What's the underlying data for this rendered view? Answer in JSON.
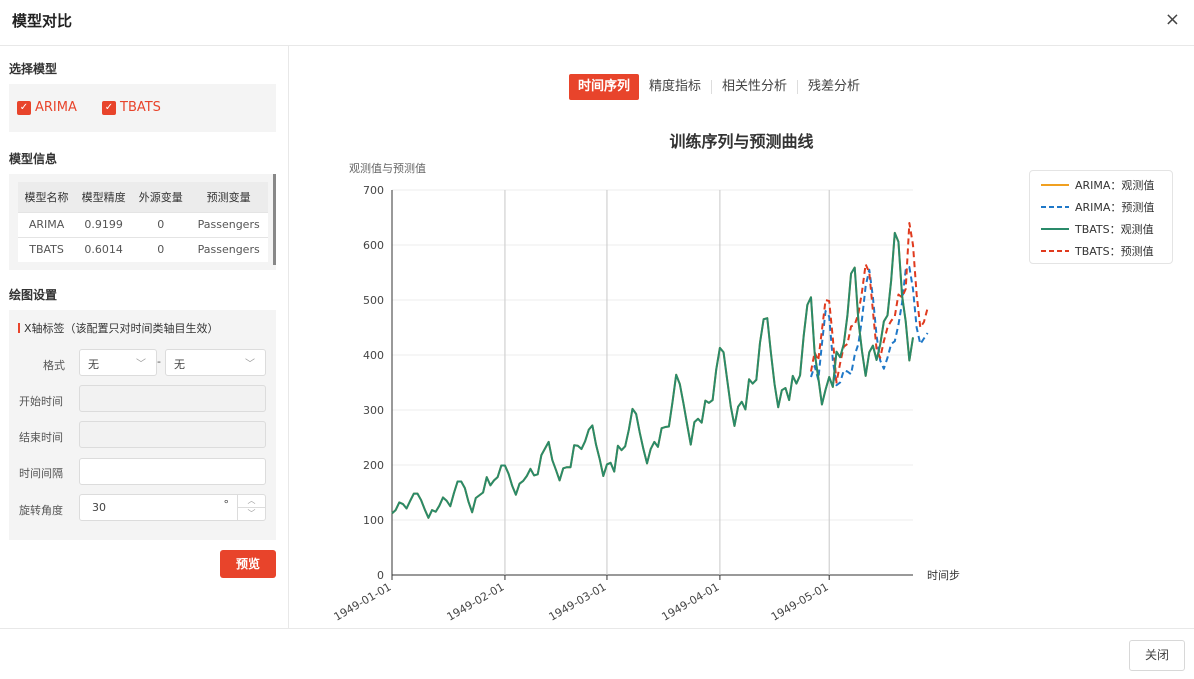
{
  "dialog": {
    "title": "模型对比",
    "close_icon": "×"
  },
  "left": {
    "select_models": {
      "title": "选择模型",
      "models": [
        {
          "label": "ARIMA",
          "checked": true
        },
        {
          "label": "TBATS",
          "checked": true
        }
      ]
    },
    "model_info": {
      "title": "模型信息",
      "columns": [
        "模型名称",
        "模型精度",
        "外源变量",
        "预测变量"
      ],
      "rows": [
        [
          "ARIMA",
          "0.9199",
          "0",
          "Passengers"
        ],
        [
          "TBATS",
          "0.6014",
          "0",
          "Passengers"
        ]
      ]
    },
    "plot_settings": {
      "title": "绘图设置",
      "subtitle": "X轴标签（该配置只对时间类轴目生效）",
      "format_label": "格式",
      "format_value_1": "无",
      "format_separator": "-",
      "format_value_2": "无",
      "start_label": "开始时间",
      "end_label": "结束时间",
      "interval_label": "时间间隔",
      "rotation_label": "旋转角度",
      "rotation_value": "30",
      "rotation_unit": "°",
      "preview_button": "预览"
    }
  },
  "tabs": [
    {
      "label": "时间序列",
      "active": true
    },
    {
      "label": "精度指标",
      "active": false
    },
    {
      "label": "相关性分析",
      "active": false
    },
    {
      "label": "残差分析",
      "active": false
    }
  ],
  "footer": {
    "close_button": "关闭"
  },
  "chart_data": {
    "type": "line",
    "title": "训练序列与预测曲线",
    "ylabel": "观测值与预测值",
    "xlabel": "时间步",
    "ylim": [
      0,
      700
    ],
    "yticks": [
      0,
      100,
      200,
      300,
      400,
      500,
      600,
      700
    ],
    "xticks": [
      "1949-01-01",
      "1949-02-01",
      "1949-03-01",
      "1949-04-01",
      "1949-05-01"
    ],
    "x_tick_positions_index": [
      0,
      31,
      59,
      90,
      120
    ],
    "legend_position": "top-right",
    "series": [
      {
        "name": "ARIMA：观测值",
        "color": "#f0a020",
        "dash": false,
        "values": [
          112,
          118,
          132,
          129,
          121,
          135,
          148,
          148,
          136,
          119,
          104,
          118,
          115,
          126,
          141,
          135,
          125,
          149,
          170,
          170,
          158,
          133,
          114,
          140,
          145,
          150,
          178,
          163,
          172,
          178,
          199,
          199,
          184,
          162,
          146,
          166,
          171,
          180,
          193,
          181,
          183,
          218,
          230,
          242,
          209,
          191,
          172,
          194,
          196,
          196,
          236,
          235,
          229,
          243,
          264,
          272,
          237,
          211,
          180,
          201,
          204,
          188,
          235,
          227,
          234,
          264,
          302,
          293,
          259,
          229,
          203,
          229,
          242,
          233,
          267,
          269,
          270,
          315,
          364,
          347,
          312,
          274,
          237,
          278,
          284,
          277,
          317,
          313,
          318,
          374,
          413,
          405,
          355,
          306,
          271,
          306,
          315,
          301,
          356,
          348,
          355,
          422,
          465,
          467,
          404,
          347,
          305,
          336,
          340,
          318,
          362,
          348,
          363,
          435,
          491,
          505,
          404,
          359,
          310,
          337,
          360,
          342,
          406,
          396,
          420,
          472,
          548,
          559,
          463,
          407,
          362,
          405,
          417,
          391,
          419,
          461,
          472,
          535,
          622,
          606,
          508,
          461,
          390,
          432
        ]
      },
      {
        "name": "ARIMA：预测值",
        "color": "#1f78c8",
        "dash": true,
        "values": [
          null,
          null,
          null,
          null,
          null,
          null,
          null,
          null,
          null,
          null,
          null,
          null,
          null,
          null,
          null,
          null,
          null,
          null,
          null,
          null,
          null,
          null,
          null,
          null,
          null,
          null,
          null,
          null,
          null,
          null,
          null,
          null,
          null,
          null,
          null,
          null,
          null,
          null,
          null,
          null,
          null,
          null,
          null,
          null,
          null,
          null,
          null,
          null,
          null,
          null,
          null,
          null,
          null,
          null,
          null,
          null,
          null,
          null,
          null,
          null,
          null,
          null,
          null,
          null,
          null,
          null,
          null,
          null,
          null,
          null,
          null,
          null,
          null,
          null,
          null,
          null,
          null,
          null,
          null,
          null,
          null,
          null,
          null,
          null,
          null,
          null,
          null,
          null,
          null,
          null,
          null,
          null,
          null,
          null,
          null,
          null,
          null,
          null,
          null,
          null,
          null,
          null,
          null,
          null,
          null,
          null,
          null,
          null,
          null,
          null,
          null,
          null,
          null,
          null,
          null,
          360,
          380,
          355,
          420,
          480,
          470,
          390,
          345,
          350,
          372,
          370,
          365,
          400,
          420,
          465,
          525,
          555,
          505,
          435,
          390,
          375,
          395,
          420,
          425,
          455,
          495,
          555,
          560,
          520,
          450,
          420,
          430,
          440
        ]
      },
      {
        "name": "TBATS：观测值",
        "color": "#2a8a6a",
        "dash": false,
        "values": [
          112,
          118,
          132,
          129,
          121,
          135,
          148,
          148,
          136,
          119,
          104,
          118,
          115,
          126,
          141,
          135,
          125,
          149,
          170,
          170,
          158,
          133,
          114,
          140,
          145,
          150,
          178,
          163,
          172,
          178,
          199,
          199,
          184,
          162,
          146,
          166,
          171,
          180,
          193,
          181,
          183,
          218,
          230,
          242,
          209,
          191,
          172,
          194,
          196,
          196,
          236,
          235,
          229,
          243,
          264,
          272,
          237,
          211,
          180,
          201,
          204,
          188,
          235,
          227,
          234,
          264,
          302,
          293,
          259,
          229,
          203,
          229,
          242,
          233,
          267,
          269,
          270,
          315,
          364,
          347,
          312,
          274,
          237,
          278,
          284,
          277,
          317,
          313,
          318,
          374,
          413,
          405,
          355,
          306,
          271,
          306,
          315,
          301,
          356,
          348,
          355,
          422,
          465,
          467,
          404,
          347,
          305,
          336,
          340,
          318,
          362,
          348,
          363,
          435,
          491,
          505,
          404,
          359,
          310,
          337,
          360,
          342,
          406,
          396,
          420,
          472,
          548,
          559,
          463,
          407,
          362,
          405,
          417,
          391,
          419,
          461,
          472,
          535,
          622,
          606,
          508,
          461,
          390,
          432
        ]
      },
      {
        "name": "TBATS：预测值",
        "color": "#e03a1e",
        "dash": true,
        "values": [
          null,
          null,
          null,
          null,
          null,
          null,
          null,
          null,
          null,
          null,
          null,
          null,
          null,
          null,
          null,
          null,
          null,
          null,
          null,
          null,
          null,
          null,
          null,
          null,
          null,
          null,
          null,
          null,
          null,
          null,
          null,
          null,
          null,
          null,
          null,
          null,
          null,
          null,
          null,
          null,
          null,
          null,
          null,
          null,
          null,
          null,
          null,
          null,
          null,
          null,
          null,
          null,
          null,
          null,
          null,
          null,
          null,
          null,
          null,
          null,
          null,
          null,
          null,
          null,
          null,
          null,
          null,
          null,
          null,
          null,
          null,
          null,
          null,
          null,
          null,
          null,
          null,
          null,
          null,
          null,
          null,
          null,
          null,
          null,
          null,
          null,
          null,
          null,
          null,
          null,
          null,
          null,
          null,
          null,
          null,
          null,
          null,
          null,
          null,
          null,
          null,
          null,
          null,
          null,
          null,
          null,
          null,
          null,
          null,
          null,
          null,
          null,
          null,
          null,
          null,
          370,
          405,
          390,
          445,
          500,
          498,
          430,
          350,
          385,
          415,
          420,
          452,
          455,
          475,
          515,
          565,
          550,
          480,
          410,
          395,
          425,
          450,
          462,
          470,
          510,
          505,
          520,
          640,
          600,
          510,
          450,
          460,
          485
        ]
      }
    ]
  }
}
